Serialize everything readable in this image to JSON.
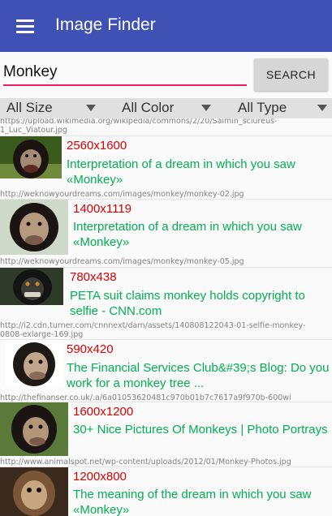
{
  "appbar": {
    "title": "Image Finder"
  },
  "search": {
    "query": "Monkey",
    "button_label": "SEARCH"
  },
  "filters": {
    "size": "All Size",
    "color": "All Color",
    "type": "All Type"
  },
  "top_url": "https://upload.wikimedia.org/wikipedia/commons/2/20/Saimin_sciureus-1_Luc_Viatour.jpg",
  "results": [
    {
      "dims": "2560x1600",
      "title": "Interpretation of a dream in which you saw «Monkey»",
      "url": "http://weknowyourdreams.com/images/monkey/monkey-02.jpg"
    },
    {
      "dims": "1400x1119",
      "title": "Interpretation of a dream in which you saw «Monkey»",
      "url": "http://weknowyourdreams.com/images/monkey/monkey-05.jpg"
    },
    {
      "dims": "780x438",
      "title": "PETA suit claims monkey holds copyright to selfie - CNN.com",
      "url": "http://i2.cdn.turner.com/cnnnext/dam/assets/140808122043-01-selfie-monkey-0808-exlarge-169.jpg"
    },
    {
      "dims": "590x420",
      "title": "The Financial Services Club&#39;s Blog: Do you work for a monkey tree ...",
      "url": "http://thefinanser.co.uk/.a/6a01053620481c970b01b7c7617a9f970b-600wi"
    },
    {
      "dims": "1600x1200",
      "title": "30+ Nice Pictures Of Monkeys | Photo Portrays",
      "url": "http://www.animalspot.net/wp-content/uploads/2012/01/Monkey-Photos.jpg"
    },
    {
      "dims": "1200x800",
      "title": "The meaning of the dream in which you saw «Monkey»",
      "url": ""
    }
  ]
}
